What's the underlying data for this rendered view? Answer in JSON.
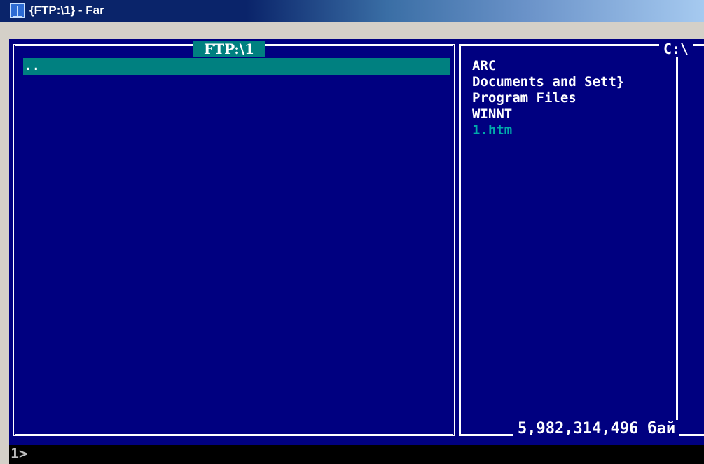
{
  "window": {
    "title": "{FTP:\\1} - Far",
    "icon": "far-manager-icon"
  },
  "left_panel": {
    "title": "FTP:\\1",
    "items": [
      ".."
    ]
  },
  "right_panel": {
    "title": "C:\\",
    "items": [
      {
        "name": "ARC",
        "type": "dir"
      },
      {
        "name": "Documents and Sett}",
        "type": "dir"
      },
      {
        "name": "Program Files",
        "type": "dir"
      },
      {
        "name": "WINNT",
        "type": "dir"
      },
      {
        "name": "1.htm",
        "type": "file"
      }
    ],
    "free_space": "5,982,314,496 бай"
  },
  "command_line": {
    "prompt": "1>"
  },
  "colors": {
    "panel_bg": "#000080",
    "cursor": "#008080",
    "file_html": "#00aaaa"
  }
}
